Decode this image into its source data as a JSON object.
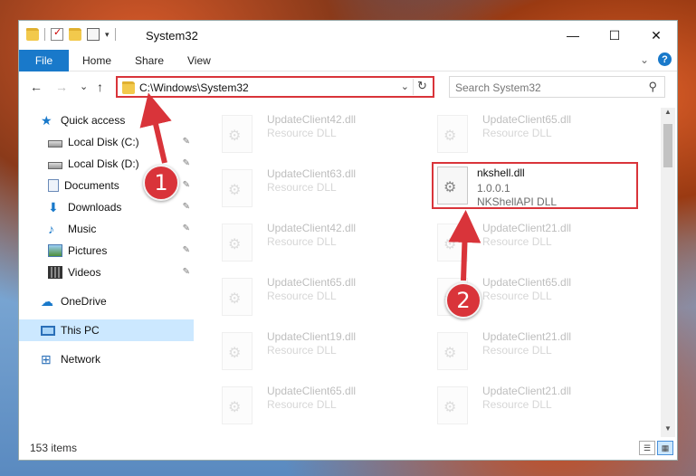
{
  "window": {
    "title": "System32",
    "minimize_glyph": "—",
    "maximize_glyph": "☐",
    "close_glyph": "✕"
  },
  "ribbon": {
    "tabs": [
      {
        "label": "File"
      },
      {
        "label": "Home"
      },
      {
        "label": "Share"
      },
      {
        "label": "View"
      }
    ],
    "expand_glyph": "⌄",
    "help_glyph": "?"
  },
  "nav": {
    "back": "←",
    "forward": "→",
    "recent": "⌄",
    "up": "↑",
    "address": "C:\\Windows\\System32",
    "address_dropdown": "⌄",
    "refresh": "↻",
    "search_placeholder": "Search System32",
    "search_icon": "⚲"
  },
  "sidebar": {
    "items": [
      {
        "label": "Quick access",
        "icon": "star-icon",
        "pinned": false
      },
      {
        "label": "Local Disk (C:)",
        "icon": "disk-icon",
        "pinned": true
      },
      {
        "label": "Local Disk (D:)",
        "icon": "disk-icon",
        "pinned": true
      },
      {
        "label": "Documents",
        "icon": "documents-icon",
        "pinned": true
      },
      {
        "label": "Downloads",
        "icon": "downloads-icon",
        "pinned": true
      },
      {
        "label": "Music",
        "icon": "music-icon",
        "pinned": true
      },
      {
        "label": "Pictures",
        "icon": "pictures-icon",
        "pinned": true
      },
      {
        "label": "Videos",
        "icon": "videos-icon",
        "pinned": true
      },
      {
        "label": "OneDrive",
        "icon": "onedrive-icon",
        "pinned": false
      },
      {
        "label": "This PC",
        "icon": "this-pc-icon",
        "pinned": false,
        "selected": true
      },
      {
        "label": "Network",
        "icon": "network-icon",
        "pinned": false
      }
    ],
    "pin_glyph": "📌"
  },
  "files": [
    {
      "name": "UpdateClient42.dll",
      "line2": "Resource DLL",
      "line3": ""
    },
    {
      "name": "UpdateClient65.dll",
      "line2": "Resource DLL",
      "line3": ""
    },
    {
      "name": "UpdateClient63.dll",
      "line2": "Resource DLL",
      "line3": ""
    },
    {
      "name": "nkshell.dll",
      "line2": "1.0.0.1",
      "line3": "NKShellAPI DLL"
    },
    {
      "name": "UpdateClient42.dll",
      "line2": "Resource DLL",
      "line3": ""
    },
    {
      "name": "UpdateClient21.dll",
      "line2": "Resource DLL",
      "line3": ""
    },
    {
      "name": "UpdateClient65.dll",
      "line2": "Resource DLL",
      "line3": ""
    },
    {
      "name": "UpdateClient65.dll",
      "line2": "Resource DLL",
      "line3": ""
    },
    {
      "name": "UpdateClient19.dll",
      "line2": "Resource DLL",
      "line3": ""
    },
    {
      "name": "UpdateClient21.dll",
      "line2": "Resource DLL",
      "line3": ""
    },
    {
      "name": "UpdateClient65.dll",
      "line2": "Resource DLL",
      "line3": ""
    },
    {
      "name": "UpdateClient21.dll",
      "line2": "Resource DLL",
      "line3": ""
    }
  ],
  "status": {
    "item_count": "153 items"
  },
  "callouts": [
    {
      "number": "1"
    },
    {
      "number": "2"
    }
  ],
  "colors": {
    "accent": "#1979ca",
    "highlight": "#d9343a",
    "selected_bg": "#cce8ff"
  }
}
